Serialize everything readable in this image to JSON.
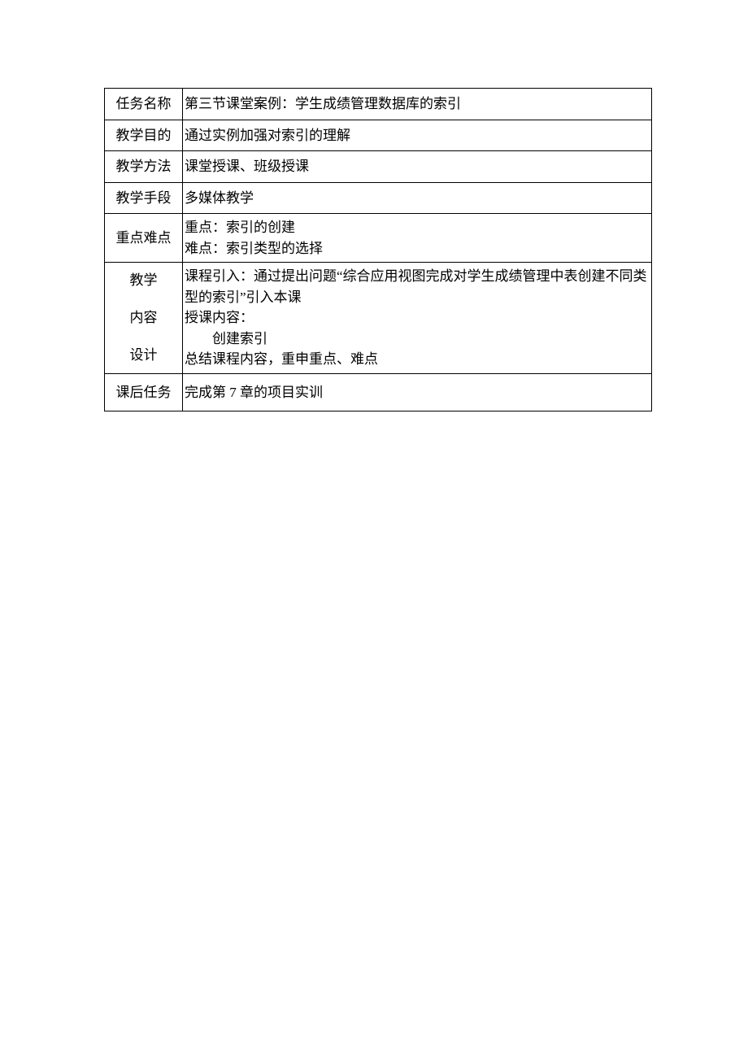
{
  "rows": {
    "task_name": {
      "label": "任务名称",
      "value": "第三节课堂案例：学生成绩管理数据库的索引"
    },
    "teaching_goal": {
      "label": "教学目的",
      "value": "通过实例加强对索引的理解"
    },
    "teaching_method": {
      "label": "教学方法",
      "value": "课堂授课、班级授课"
    },
    "teaching_means": {
      "label": "教学手段",
      "value": "多媒体教学"
    },
    "key_points": {
      "label": "重点难点",
      "line1": "重点：索引的创建",
      "line2": "难点：索引类型的选择"
    },
    "design": {
      "label1": "教学",
      "label2": "内容",
      "label3": "设计",
      "intro": "课程引入：通过提出问题“综合应用视图完成对学生成绩管理中表创建不同类型的索引”引入本课",
      "content_title": "授课内容：",
      "content_item": "创建索引",
      "summary": "总结课程内容，重申重点、难点"
    },
    "homework": {
      "label": "课后任务",
      "value": "完成第 7 章的项目实训"
    }
  }
}
